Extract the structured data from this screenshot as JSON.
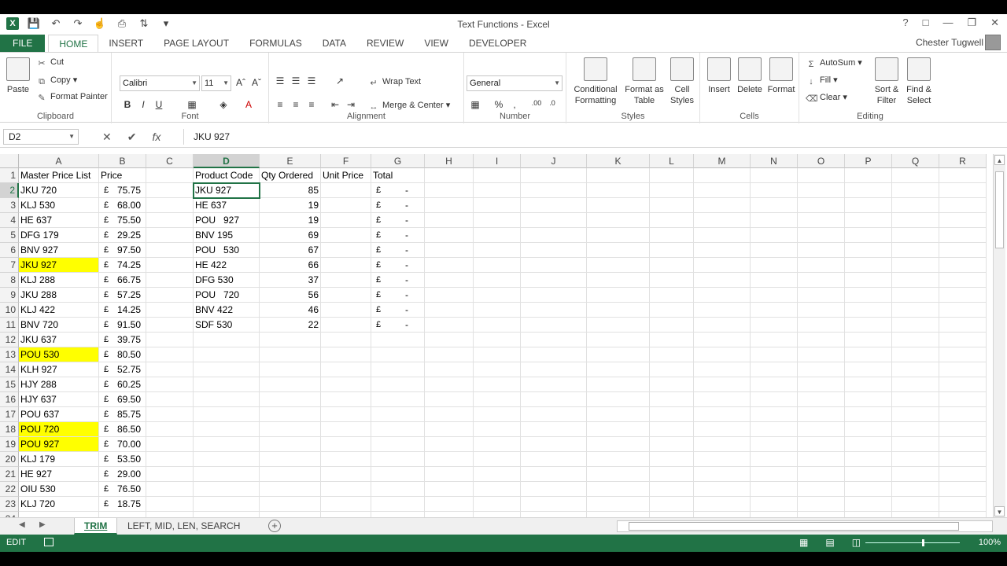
{
  "window": {
    "title": "Text Functions - Excel",
    "app_icon": "X",
    "help": "?",
    "controls": [
      "□",
      "—",
      "❐",
      "✕"
    ]
  },
  "qat": {
    "save_icon": "save-icon",
    "undo_icon": "undo-icon",
    "redo_icon": "redo-icon",
    "touch_icon": "touch-mode-icon",
    "print_icon": "print-preview-icon",
    "sort_icon": "sort-icon",
    "customize_icon": "customize-qat-icon"
  },
  "ribbon_tabs": [
    "FILE",
    "HOME",
    "INSERT",
    "PAGE LAYOUT",
    "FORMULAS",
    "DATA",
    "REVIEW",
    "VIEW",
    "DEVELOPER"
  ],
  "active_tab": "HOME",
  "user": "Chester Tugwell",
  "ribbon": {
    "clipboard": {
      "paste": "Paste",
      "cut": "Cut",
      "copy": "Copy",
      "format_painter": "Format Painter",
      "label": "Clipboard"
    },
    "font": {
      "name": "Calibri",
      "size": "11",
      "bold": "B",
      "italic": "I",
      "underline": "U",
      "label": "Font"
    },
    "alignment": {
      "wrap": "Wrap Text",
      "merge": "Merge & Center",
      "label": "Alignment"
    },
    "number": {
      "format": "General",
      "label": "Number"
    },
    "styles": {
      "conditional": "Conditional",
      "conditional2": "Formatting",
      "format_as": "Format as",
      "format_as2": "Table",
      "cell": "Cell",
      "cell2": "Styles",
      "label": "Styles"
    },
    "cells": {
      "insert": "Insert",
      "delete": "Delete",
      "format": "Format",
      "label": "Cells"
    },
    "editing": {
      "autosum": "AutoSum",
      "fill": "Fill",
      "clear": "Clear",
      "sort": "Sort &",
      "sort2": "Filter",
      "find": "Find &",
      "find2": "Select",
      "label": "Editing"
    }
  },
  "formula_bar": {
    "name_box": "D2",
    "cancel": "✕",
    "enter": "✔",
    "fx": "fx",
    "content": "JKU 927"
  },
  "columns": [
    "A",
    "B",
    "C",
    "D",
    "E",
    "F",
    "G",
    "H",
    "I",
    "J",
    "K",
    "L",
    "M",
    "N",
    "O",
    "P",
    "Q",
    "R"
  ],
  "selected_column": "D",
  "selected_row": 2,
  "header_row": [
    "Master Price List",
    "Price",
    "",
    "Product Code",
    "Qty Ordered",
    "Unit Price",
    "Total"
  ],
  "master_list": [
    {
      "code": "JKU 720",
      "price": "75.75",
      "yellow": false
    },
    {
      "code": "KLJ 530",
      "price": "68.00",
      "yellow": false
    },
    {
      "code": "HE 637",
      "price": "75.50",
      "yellow": false
    },
    {
      "code": "DFG 179",
      "price": "29.25",
      "yellow": false
    },
    {
      "code": "BNV 927",
      "price": "97.50",
      "yellow": false
    },
    {
      "code": "JKU 927",
      "price": "74.25",
      "yellow": true
    },
    {
      "code": "KLJ 288",
      "price": "66.75",
      "yellow": false
    },
    {
      "code": "JKU 288",
      "price": "57.25",
      "yellow": false
    },
    {
      "code": "KLJ 422",
      "price": "14.25",
      "yellow": false
    },
    {
      "code": "BNV 720",
      "price": "91.50",
      "yellow": false
    },
    {
      "code": "JKU 637",
      "price": "39.75",
      "yellow": false
    },
    {
      "code": "POU 530",
      "price": "80.50",
      "yellow": true
    },
    {
      "code": "KLH 927",
      "price": "52.75",
      "yellow": false
    },
    {
      "code": "HJY 288",
      "price": "60.25",
      "yellow": false
    },
    {
      "code": "HJY 637",
      "price": "69.50",
      "yellow": false
    },
    {
      "code": "POU 637",
      "price": "85.75",
      "yellow": false
    },
    {
      "code": "POU 720",
      "price": "86.50",
      "yellow": true
    },
    {
      "code": "POU 927",
      "price": "70.00",
      "yellow": true
    },
    {
      "code": "KLJ 179",
      "price": "53.50",
      "yellow": false
    },
    {
      "code": "HE 927",
      "price": "29.00",
      "yellow": false
    },
    {
      "code": "OIU 530",
      "price": "76.50",
      "yellow": false
    },
    {
      "code": "KLJ 720",
      "price": "18.75",
      "yellow": false
    }
  ],
  "currency": "£",
  "orders": [
    {
      "code": "JKU 927",
      "qty": "85",
      "total": "-"
    },
    {
      "code": "HE 637",
      "qty": "19",
      "total": "-"
    },
    {
      "code": "POU   927",
      "qty": "19",
      "total": "-"
    },
    {
      "code": "BNV 195",
      "qty": "69",
      "total": "-"
    },
    {
      "code": "POU   530",
      "qty": "67",
      "total": "-"
    },
    {
      "code": "HE 422",
      "qty": "66",
      "total": "-"
    },
    {
      "code": "DFG 530",
      "qty": "37",
      "total": "-"
    },
    {
      "code": "POU   720",
      "qty": "56",
      "total": "-"
    },
    {
      "code": "BNV 422",
      "qty": "46",
      "total": "-"
    },
    {
      "code": "SDF 530",
      "qty": "22",
      "total": "-"
    }
  ],
  "sheets": [
    "TRIM",
    "LEFT, MID, LEN, SEARCH"
  ],
  "active_sheet": "TRIM",
  "status": {
    "mode": "EDIT",
    "zoom": "100%"
  }
}
